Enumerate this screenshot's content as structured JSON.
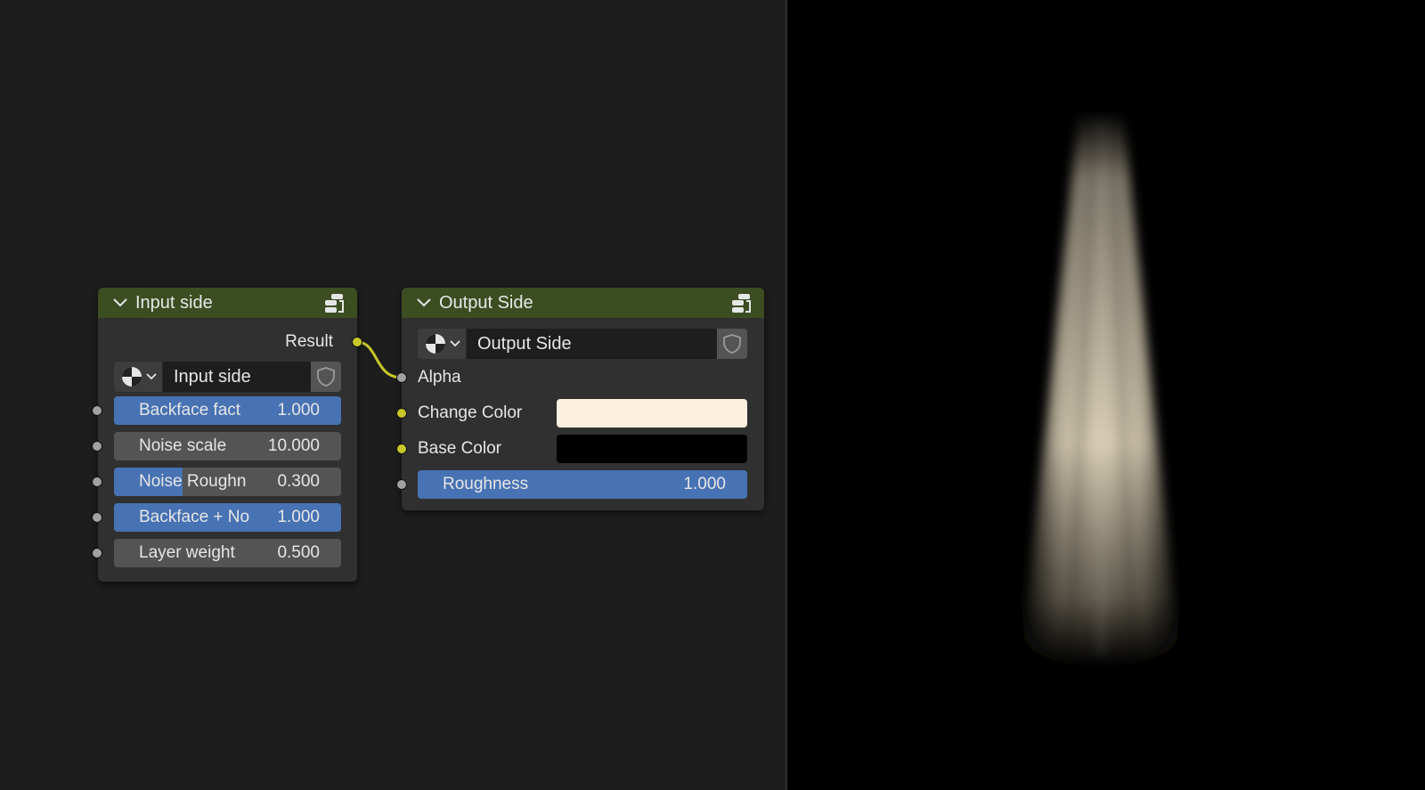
{
  "input_node": {
    "title": "Input side",
    "output_label": "Result",
    "group_name": "Input side",
    "fields": [
      {
        "label": "Backface fact",
        "value": "1.000",
        "fill": 1.0
      },
      {
        "label": "Noise scale",
        "value": "10.000",
        "fill": 0.0
      },
      {
        "label": "Noise Roughn",
        "value": "0.300",
        "fill": 0.3
      },
      {
        "label": "Backface + No",
        "value": "1.000",
        "fill": 1.0
      },
      {
        "label": "Layer weight",
        "value": "0.500",
        "fill": 0.0
      }
    ]
  },
  "output_node": {
    "title": "Output Side",
    "group_name": "Output Side",
    "alpha_label": "Alpha",
    "change_color_label": "Change Color",
    "change_color": "#fdf0de",
    "base_color_label": "Base Color",
    "base_color": "#000000",
    "roughness_label": "Roughness",
    "roughness_value": "1.000",
    "roughness_fill": 1.0
  },
  "colors": {
    "header": "#3b4d21",
    "slider_fill": "#4772b3",
    "socket_float": "#a1a1a1",
    "socket_color": "#c7c729",
    "render_light": "#e8dcc2"
  },
  "icons": {
    "collapse": "chevron-down-icon",
    "node_group": "node-group-icon",
    "material": "material-sphere-icon",
    "fake_user": "shield-icon"
  }
}
